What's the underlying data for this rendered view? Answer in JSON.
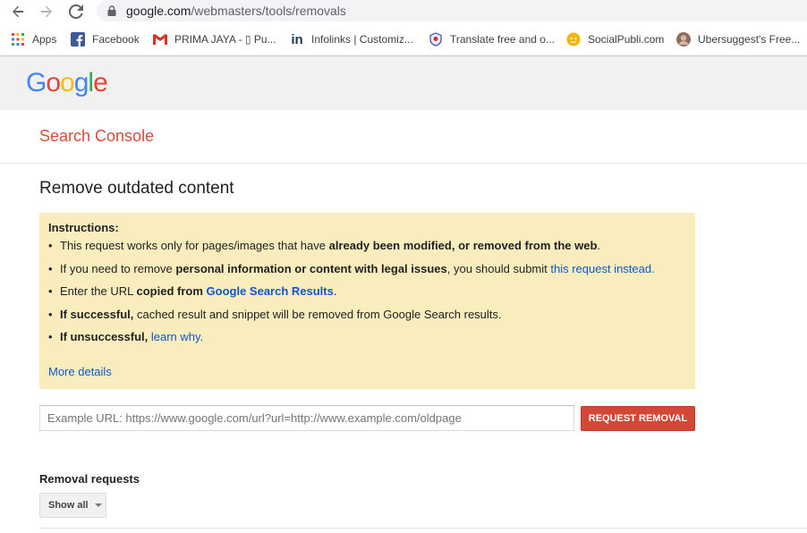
{
  "browser": {
    "url_host": "google.com",
    "url_path": "/webmasters/tools/removals",
    "bookmarks": [
      {
        "label": "Apps",
        "icon": "apps-grid-icon"
      },
      {
        "label": "Facebook",
        "icon": "facebook-icon"
      },
      {
        "label": "PRIMA JAYA - ▯ Pu...",
        "icon": "gmail-icon"
      },
      {
        "label": "Infolinks | Customiz...",
        "icon": "infolinks-icon"
      },
      {
        "label": "Translate free and o...",
        "icon": "translate-icon"
      },
      {
        "label": "SocialPubli.com",
        "icon": "socialpubli-icon"
      },
      {
        "label": "Ubersuggest's Free...",
        "icon": "ubersuggest-avatar-icon"
      }
    ]
  },
  "header": {
    "logo_letters": [
      "G",
      "o",
      "o",
      "g",
      "l",
      "e"
    ],
    "logo_colors": [
      "#4285f4",
      "#ea4335",
      "#fbbc05",
      "#4285f4",
      "#34a853",
      "#ea4335"
    ]
  },
  "console": {
    "title": "Search Console"
  },
  "page": {
    "title": "Remove outdated content"
  },
  "instructions": {
    "heading": "Instructions:",
    "items": [
      {
        "a": "This request works only for pages/images that have ",
        "b": "already been modified, or removed from the web",
        "c": "."
      },
      {
        "a": "If you need to remove ",
        "b": "personal information or content with legal issues",
        "c": ", you should submit ",
        "link": "this request instead",
        "d": "."
      },
      {
        "a": "Enter the URL ",
        "b": "copied from ",
        "link": "Google Search Results",
        "d": "."
      },
      {
        "b": "If successful,",
        "c": " cached result and snippet will be removed from Google Search results."
      },
      {
        "b": "If unsuccessful,",
        "c": " ",
        "link": "learn why",
        "d": "."
      }
    ],
    "more_details": "More details"
  },
  "form": {
    "placeholder": "Example URL: https://www.google.com/url?url=http://www.example.com/oldpage",
    "button_label": "REQUEST REMOVAL"
  },
  "removals": {
    "title": "Removal requests",
    "filter_label": "Show all"
  },
  "colors": {
    "console_red": "#dd4b39",
    "button_red": "#d14836",
    "notice_bg": "#f9edbe",
    "link_blue": "#1155cc"
  }
}
